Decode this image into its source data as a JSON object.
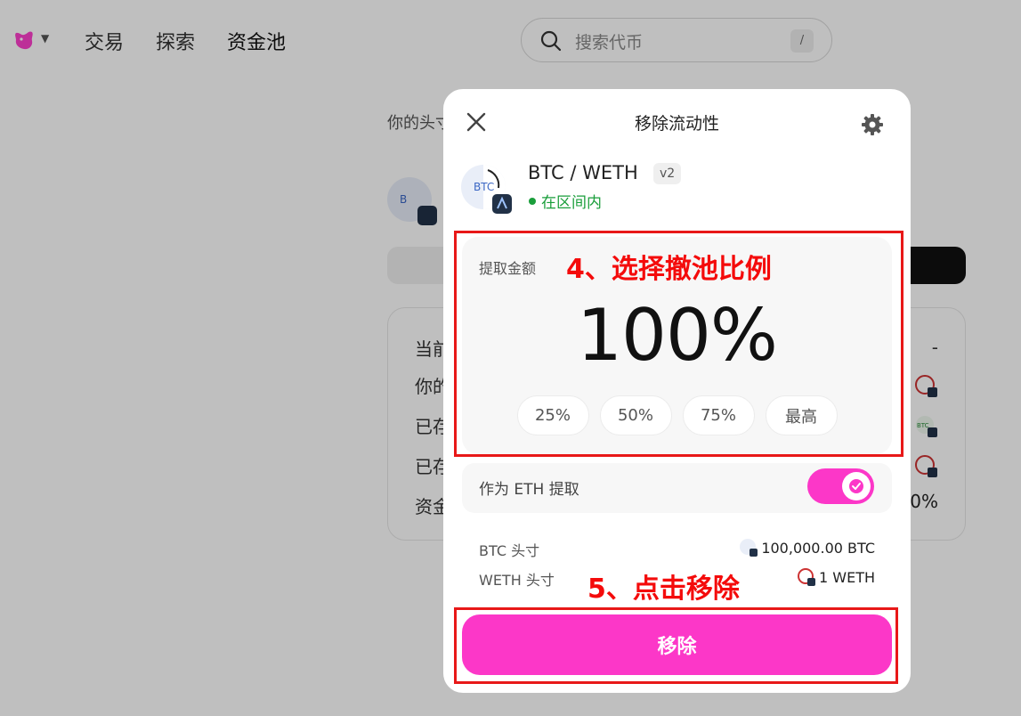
{
  "nav": {
    "links": [
      "交易",
      "探索",
      "资金池"
    ]
  },
  "search": {
    "placeholder": "搜索代币",
    "shortcut": "/"
  },
  "background": {
    "heading": "你的头寸",
    "card_rows": [
      "当前",
      "你的",
      "已存",
      "已存",
      "资金"
    ],
    "dash": "-",
    "share": "00%",
    "token_label": "BTC"
  },
  "modal": {
    "title": "移除流动性",
    "pair": {
      "name": "BTC / WETH",
      "version": "v2",
      "status": "在区间内",
      "logo_text": "BTC"
    },
    "amount": {
      "label": "提取金额",
      "value": "100%",
      "presets": [
        "25%",
        "50%",
        "75%",
        "最高"
      ]
    },
    "eth_option": {
      "label": "作为 ETH 提取",
      "enabled": true
    },
    "positions": [
      {
        "label": "BTC 头寸",
        "value": "100,000.00 BTC"
      },
      {
        "label": "WETH 头寸",
        "value": "1 WETH"
      }
    ],
    "remove_label": "移除"
  },
  "annotations": {
    "step4": "4、选择撤池比例",
    "step5": "5、点击移除"
  },
  "colors": {
    "accent": "#fc37c8",
    "status_green": "#1a9e3b",
    "annotation_red": "#e81818"
  }
}
